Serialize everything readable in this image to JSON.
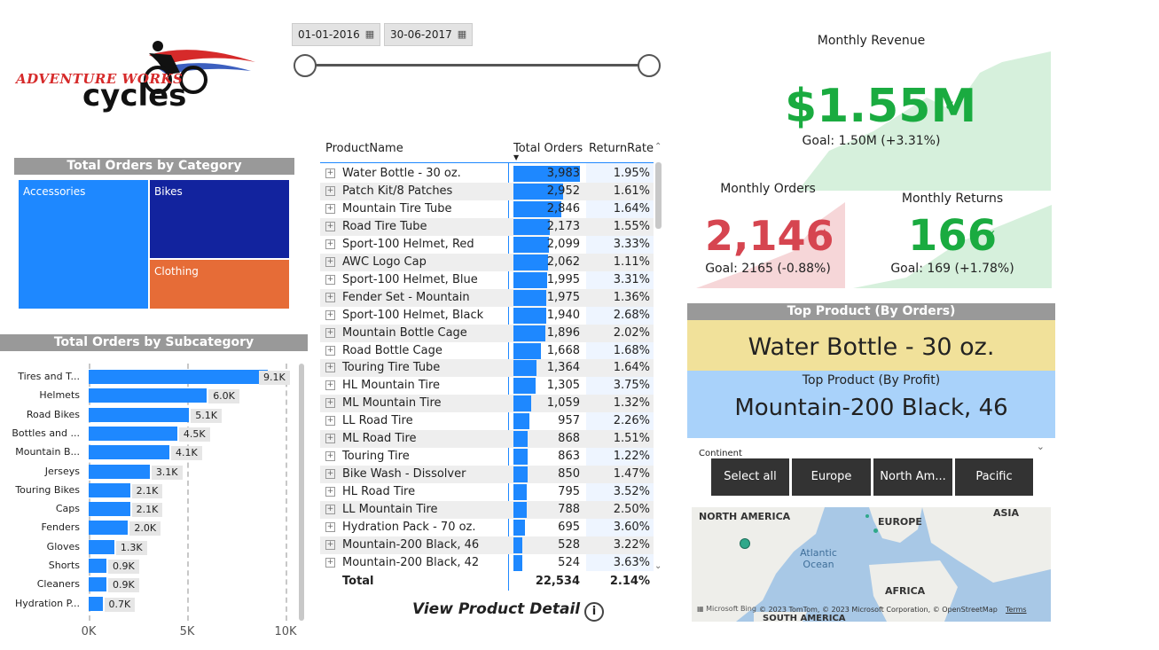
{
  "logo": {
    "line1": "ADVENTURE WORKS",
    "line2": "cycles"
  },
  "date_range": {
    "start": "01-01-2016",
    "end": "30-06-2017"
  },
  "category_chart": {
    "title": "Total Orders by Category",
    "tiles": [
      {
        "label": "Accessories",
        "color": "#1e88ff"
      },
      {
        "label": "Bikes",
        "color": "#12239e"
      },
      {
        "label": "Clothing",
        "color": "#e66c37"
      }
    ]
  },
  "chart_data": {
    "type": "bar",
    "title": "Total Orders by Subcategory",
    "orientation": "horizontal",
    "categories": [
      "Tires and T...",
      "Helmets",
      "Road Bikes",
      "Bottles and ...",
      "Mountain B...",
      "Jerseys",
      "Touring Bikes",
      "Caps",
      "Fenders",
      "Gloves",
      "Shorts",
      "Cleaners",
      "Hydration P..."
    ],
    "values": [
      9100,
      6000,
      5100,
      4500,
      4100,
      3100,
      2100,
      2100,
      2000,
      1300,
      900,
      900,
      700
    ],
    "value_labels": [
      "9.1K",
      "6.0K",
      "5.1K",
      "4.5K",
      "4.1K",
      "3.1K",
      "2.1K",
      "2.1K",
      "2.0K",
      "1.3K",
      "0.9K",
      "0.9K",
      "0.7K"
    ],
    "xlim": [
      0,
      10000
    ],
    "xticks": [
      "0K",
      "5K",
      "10K"
    ],
    "grid": true
  },
  "product_table": {
    "headers": {
      "name": "ProductName",
      "orders": "Total Orders",
      "rr": "ReturnRate"
    },
    "rows": [
      {
        "name": "Water Bottle - 30 oz.",
        "orders": "3,983",
        "orders_n": 3983,
        "rr": "1.95%"
      },
      {
        "name": "Patch Kit/8 Patches",
        "orders": "2,952",
        "orders_n": 2952,
        "rr": "1.61%"
      },
      {
        "name": "Mountain Tire Tube",
        "orders": "2,846",
        "orders_n": 2846,
        "rr": "1.64%"
      },
      {
        "name": "Road Tire Tube",
        "orders": "2,173",
        "orders_n": 2173,
        "rr": "1.55%"
      },
      {
        "name": "Sport-100 Helmet, Red",
        "orders": "2,099",
        "orders_n": 2099,
        "rr": "3.33%"
      },
      {
        "name": "AWC Logo Cap",
        "orders": "2,062",
        "orders_n": 2062,
        "rr": "1.11%"
      },
      {
        "name": "Sport-100 Helmet, Blue",
        "orders": "1,995",
        "orders_n": 1995,
        "rr": "3.31%"
      },
      {
        "name": "Fender Set - Mountain",
        "orders": "1,975",
        "orders_n": 1975,
        "rr": "1.36%"
      },
      {
        "name": "Sport-100 Helmet, Black",
        "orders": "1,940",
        "orders_n": 1940,
        "rr": "2.68%"
      },
      {
        "name": "Mountain Bottle Cage",
        "orders": "1,896",
        "orders_n": 1896,
        "rr": "2.02%"
      },
      {
        "name": "Road Bottle Cage",
        "orders": "1,668",
        "orders_n": 1668,
        "rr": "1.68%"
      },
      {
        "name": "Touring Tire Tube",
        "orders": "1,364",
        "orders_n": 1364,
        "rr": "1.64%"
      },
      {
        "name": "HL Mountain Tire",
        "orders": "1,305",
        "orders_n": 1305,
        "rr": "3.75%"
      },
      {
        "name": "ML Mountain Tire",
        "orders": "1,059",
        "orders_n": 1059,
        "rr": "1.32%"
      },
      {
        "name": "LL Road Tire",
        "orders": "957",
        "orders_n": 957,
        "rr": "2.26%"
      },
      {
        "name": "ML Road Tire",
        "orders": "868",
        "orders_n": 868,
        "rr": "1.51%"
      },
      {
        "name": "Touring Tire",
        "orders": "863",
        "orders_n": 863,
        "rr": "1.22%"
      },
      {
        "name": "Bike Wash - Dissolver",
        "orders": "850",
        "orders_n": 850,
        "rr": "1.47%"
      },
      {
        "name": "HL Road Tire",
        "orders": "795",
        "orders_n": 795,
        "rr": "3.52%"
      },
      {
        "name": "LL Mountain Tire",
        "orders": "788",
        "orders_n": 788,
        "rr": "2.50%"
      },
      {
        "name": "Hydration Pack - 70 oz.",
        "orders": "695",
        "orders_n": 695,
        "rr": "3.60%"
      },
      {
        "name": "Mountain-200 Black, 46",
        "orders": "528",
        "orders_n": 528,
        "rr": "3.22%"
      },
      {
        "name": "Mountain-200 Black, 42",
        "orders": "524",
        "orders_n": 524,
        "rr": "3.63%"
      }
    ],
    "total": {
      "label": "Total",
      "orders": "22,534",
      "rr": "2.14%"
    }
  },
  "detail_link": "View Product Detail",
  "kpis": {
    "revenue": {
      "title": "Monthly Revenue",
      "value": "$1.55M",
      "goal": "Goal: 1.50M (+3.31%)",
      "status_icon": "check-icon",
      "color": "#1aab40"
    },
    "orders": {
      "title": "Monthly Orders",
      "value": "2,146",
      "goal": "Goal: 2165 (-0.88%)",
      "status_icon": "exclamation-icon",
      "color": "#d64550"
    },
    "returns": {
      "title": "Monthly Returns",
      "value": "166",
      "goal": "Goal: 169 (+1.78%)",
      "status_icon": "check-icon",
      "color": "#1aab40"
    }
  },
  "top_product_orders": {
    "title": "Top Product (By Orders)",
    "value": "Water Bottle - 30 oz."
  },
  "top_product_profit": {
    "title": "Top Product (By Profit)",
    "value": "Mountain-200 Black, 46"
  },
  "continent_slicer": {
    "title": "Continent",
    "options": [
      "Select all",
      "Europe",
      "North Am...",
      "Pacific"
    ]
  },
  "map": {
    "labels": {
      "na": "NORTH AMERICA",
      "eu": "EUROPE",
      "asia": "ASIA",
      "ocean": "Atlantic\nOcean",
      "africa": "AFRICA",
      "sa": "SOUTH AMERICA"
    },
    "attribution": "© 2023 TomTom, © 2023 Microsoft Corporation, © OpenStreetMap",
    "terms": "Terms",
    "brand": "Microsoft Bing"
  }
}
